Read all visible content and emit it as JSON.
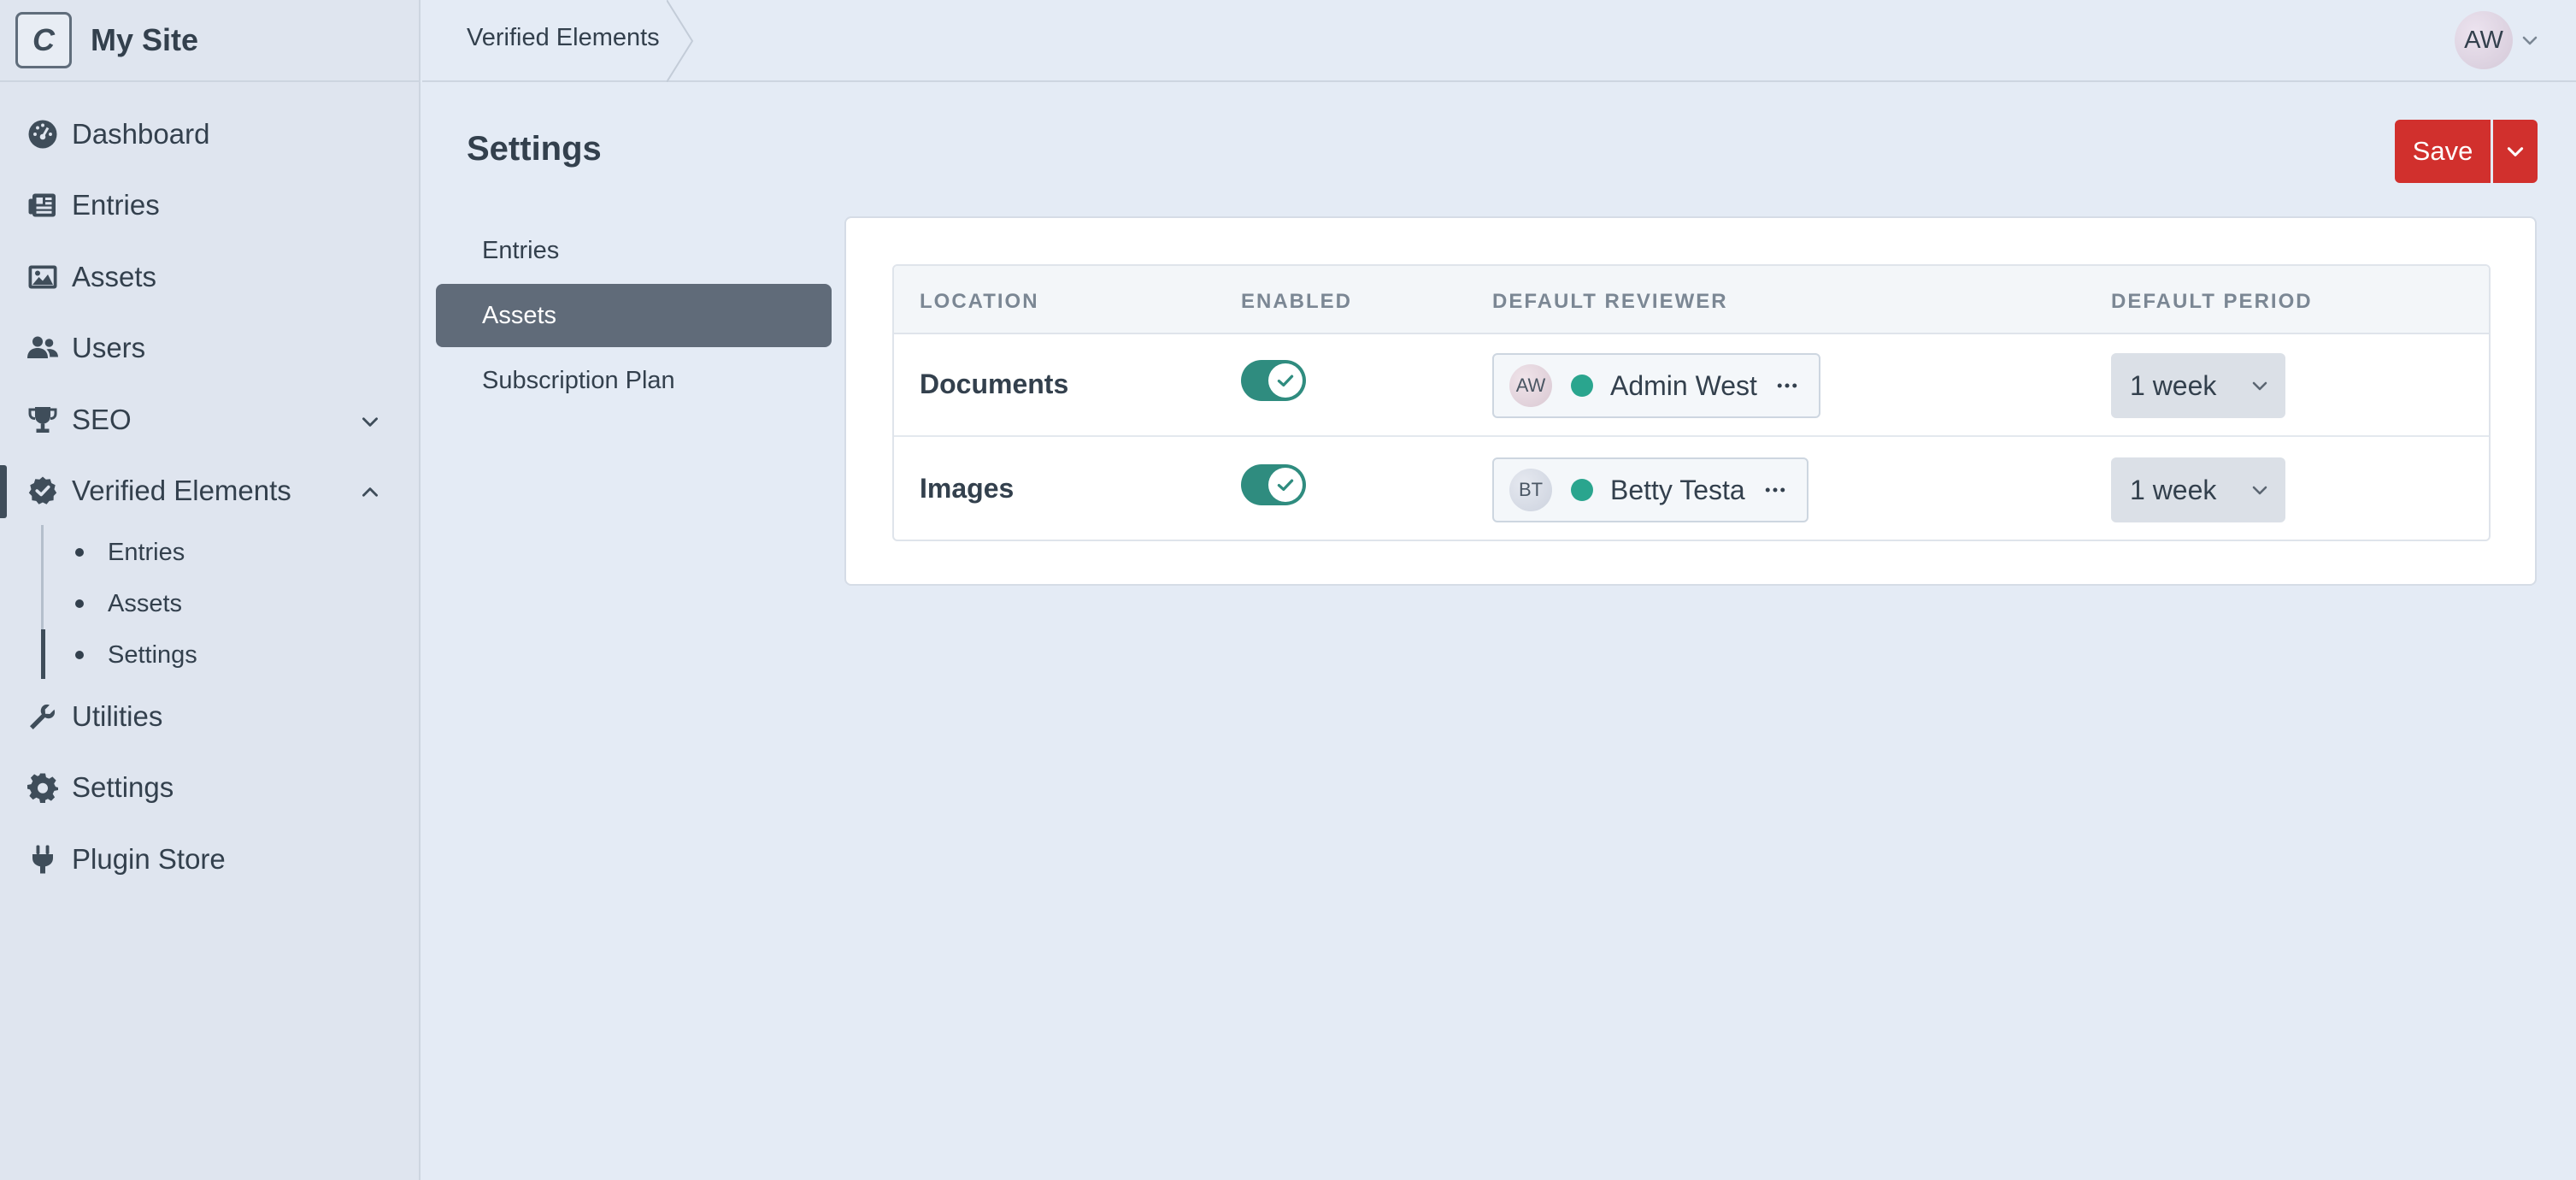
{
  "site": {
    "logo_letter": "C",
    "name": "My Site"
  },
  "nav": {
    "dashboard": "Dashboard",
    "entries": "Entries",
    "assets": "Assets",
    "users": "Users",
    "seo": "SEO",
    "verified_elements": "Verified Elements",
    "sub": {
      "entries": "Entries",
      "assets": "Assets",
      "settings": "Settings"
    },
    "utilities": "Utilities",
    "settings": "Settings",
    "plugin_store": "Plugin Store"
  },
  "breadcrumb": {
    "item": "Verified Elements"
  },
  "user": {
    "initials": "AW"
  },
  "page": {
    "title": "Settings",
    "save_label": "Save"
  },
  "settings_nav": {
    "entries": "Entries",
    "assets": "Assets",
    "subscription_plan": "Subscription Plan",
    "active": "Assets"
  },
  "table": {
    "headers": {
      "location": "LOCATION",
      "enabled": "ENABLED",
      "default_reviewer": "DEFAULT REVIEWER",
      "default_period": "DEFAULT PERIOD"
    },
    "rows": [
      {
        "location": "Documents",
        "enabled": true,
        "reviewer": {
          "initials": "AW",
          "name": "Admin West"
        },
        "period": "1 week"
      },
      {
        "location": "Images",
        "enabled": true,
        "reviewer": {
          "initials": "BT",
          "name": "Betty Testa"
        },
        "period": "1 week"
      }
    ]
  },
  "colors": {
    "primary_button": "#d1302d",
    "toggle_on": "#2f8c7f",
    "status_online": "#2aa58e",
    "active_nav": "#606b79"
  }
}
